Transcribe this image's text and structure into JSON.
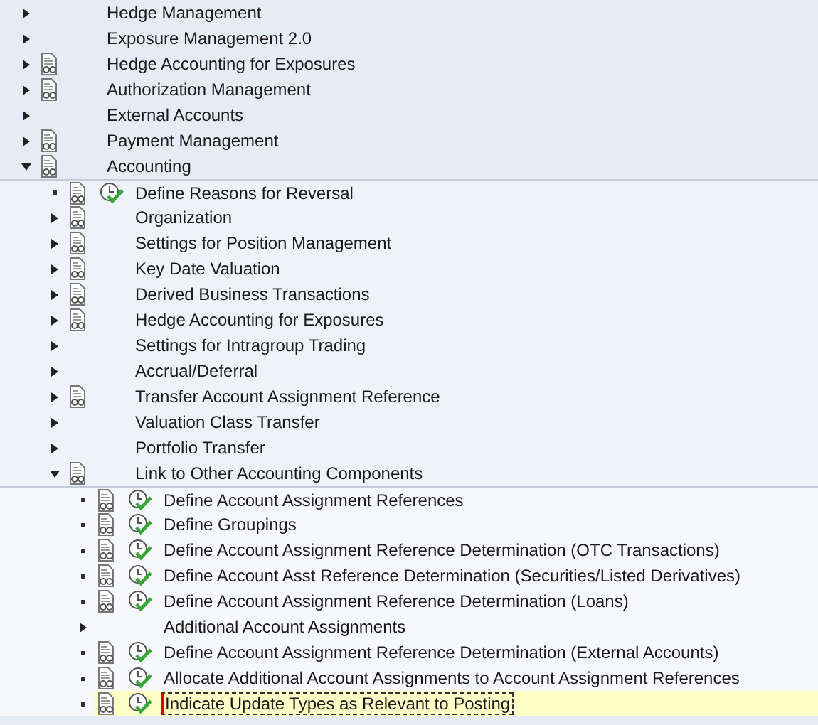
{
  "tree": [
    {
      "label": "Hedge Management",
      "kind": "folder",
      "expanded": false,
      "documentation": false,
      "selected": false
    },
    {
      "label": "Exposure Management 2.0",
      "kind": "folder",
      "expanded": false,
      "documentation": false,
      "selected": false
    },
    {
      "label": "Hedge Accounting for Exposures",
      "kind": "folder",
      "expanded": false,
      "documentation": true,
      "selected": false
    },
    {
      "label": "Authorization Management",
      "kind": "folder",
      "expanded": false,
      "documentation": true,
      "selected": false
    },
    {
      "label": "External Accounts",
      "kind": "folder",
      "expanded": false,
      "documentation": false,
      "selected": false
    },
    {
      "label": "Payment Management",
      "kind": "folder",
      "expanded": false,
      "documentation": true,
      "selected": false
    },
    {
      "label": "Accounting",
      "kind": "folder",
      "expanded": true,
      "documentation": true,
      "selected": false,
      "children": [
        {
          "label": "Define Reasons for Reversal",
          "kind": "activity",
          "documentation": true,
          "executable": true,
          "selected": false
        },
        {
          "label": "Organization",
          "kind": "folder",
          "expanded": false,
          "documentation": true,
          "selected": false
        },
        {
          "label": "Settings for Position Management",
          "kind": "folder",
          "expanded": false,
          "documentation": true,
          "selected": false
        },
        {
          "label": "Key Date Valuation",
          "kind": "folder",
          "expanded": false,
          "documentation": true,
          "selected": false
        },
        {
          "label": "Derived Business Transactions",
          "kind": "folder",
          "expanded": false,
          "documentation": true,
          "selected": false
        },
        {
          "label": "Hedge Accounting for Exposures",
          "kind": "folder",
          "expanded": false,
          "documentation": true,
          "selected": false
        },
        {
          "label": "Settings for Intragroup Trading",
          "kind": "folder",
          "expanded": false,
          "documentation": false,
          "selected": false
        },
        {
          "label": "Accrual/Deferral",
          "kind": "folder",
          "expanded": false,
          "documentation": false,
          "selected": false
        },
        {
          "label": "Transfer Account Assignment Reference",
          "kind": "folder",
          "expanded": false,
          "documentation": true,
          "selected": false
        },
        {
          "label": "Valuation Class Transfer",
          "kind": "folder",
          "expanded": false,
          "documentation": false,
          "selected": false
        },
        {
          "label": "Portfolio Transfer",
          "kind": "folder",
          "expanded": false,
          "documentation": false,
          "selected": false
        },
        {
          "label": "Link to Other Accounting Components",
          "kind": "folder",
          "expanded": true,
          "documentation": true,
          "selected": false,
          "children": [
            {
              "label": "Define Account Assignment References",
              "kind": "activity",
              "documentation": true,
              "executable": true,
              "selected": false
            },
            {
              "label": "Define Groupings",
              "kind": "activity",
              "documentation": true,
              "executable": true,
              "selected": false
            },
            {
              "label": "Define Account Assignment Reference Determination (OTC Transactions)",
              "kind": "activity",
              "documentation": true,
              "executable": true,
              "selected": false
            },
            {
              "label": "Define Account Asst Reference Determination (Securities/Listed Derivatives)",
              "kind": "activity",
              "documentation": true,
              "executable": true,
              "selected": false
            },
            {
              "label": "Define Account Assignment Reference Determination (Loans)",
              "kind": "activity",
              "documentation": true,
              "executable": true,
              "selected": false
            },
            {
              "label": "Additional Account Assignments",
              "kind": "folder",
              "expanded": false,
              "documentation": false,
              "selected": false
            },
            {
              "label": "Define Account Assignment Reference Determination (External Accounts)",
              "kind": "activity",
              "documentation": true,
              "executable": true,
              "selected": false
            },
            {
              "label": "Allocate Additional Account Assignments to Account Assignment References",
              "kind": "activity",
              "documentation": true,
              "executable": true,
              "selected": false
            },
            {
              "label": "Indicate Update Types as Relevant to Posting",
              "kind": "activity",
              "documentation": true,
              "executable": true,
              "selected": true
            }
          ]
        }
      ]
    }
  ]
}
